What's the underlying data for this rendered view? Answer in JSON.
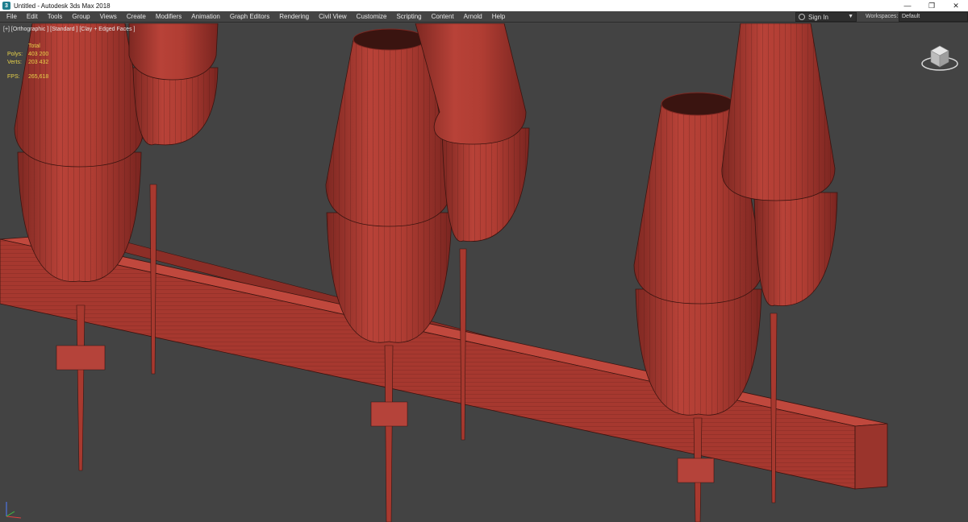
{
  "window": {
    "title": "Untitled - Autodesk 3ds Max 2018",
    "app_icon_glyph": "3",
    "controls": {
      "minimize": "—",
      "restore": "❐",
      "close": "✕"
    }
  },
  "menubar": {
    "items": [
      "File",
      "Edit",
      "Tools",
      "Group",
      "Views",
      "Create",
      "Modifiers",
      "Animation",
      "Graph Editors",
      "Rendering",
      "Civil View",
      "Customize",
      "Scripting",
      "Content",
      "Arnold",
      "Help"
    ],
    "signin_label": "Sign In",
    "workspaces_label": "Workspaces:",
    "workspace_value": "Default"
  },
  "viewport": {
    "label": "[+] [Orthographic ] [Standard ] [Clay + Edged Faces ]",
    "stats": {
      "header": "Total",
      "polys_label": "Polys:",
      "polys_value": "403 200",
      "verts_label": "Verts:",
      "verts_value": "203 432",
      "fps_label": "FPS:",
      "fps_value": "265,618"
    }
  },
  "colors": {
    "clay": "#b03d33",
    "clay_dark": "#7e2822",
    "wire": "#3a1410",
    "viewport_bg": "#434343",
    "stats_text": "#e8d34a"
  }
}
